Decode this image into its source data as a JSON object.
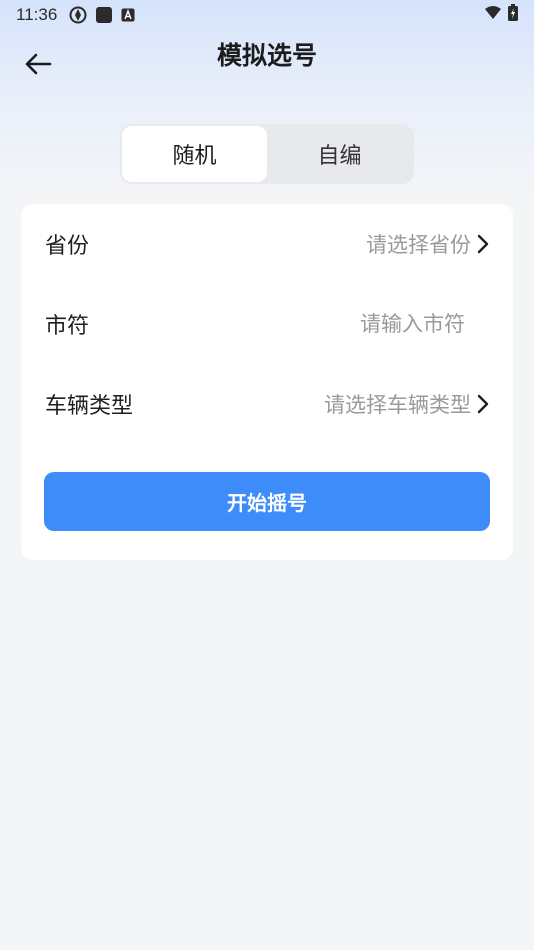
{
  "status_bar": {
    "time": "11:36"
  },
  "header": {
    "title": "模拟选号"
  },
  "tabs": [
    {
      "label": "随机",
      "active": true
    },
    {
      "label": "自编",
      "active": false
    }
  ],
  "form": {
    "province": {
      "label": "省份",
      "placeholder": "请选择省份"
    },
    "city_code": {
      "label": "市符",
      "placeholder": "请输入市符"
    },
    "vehicle_type": {
      "label": "车辆类型",
      "placeholder": "请选择车辆类型"
    }
  },
  "actions": {
    "start_label": "开始摇号"
  },
  "colors": {
    "accent": "#3e8bfa",
    "background": "#f4f5f7",
    "placeholder": "#9a9a9a"
  }
}
